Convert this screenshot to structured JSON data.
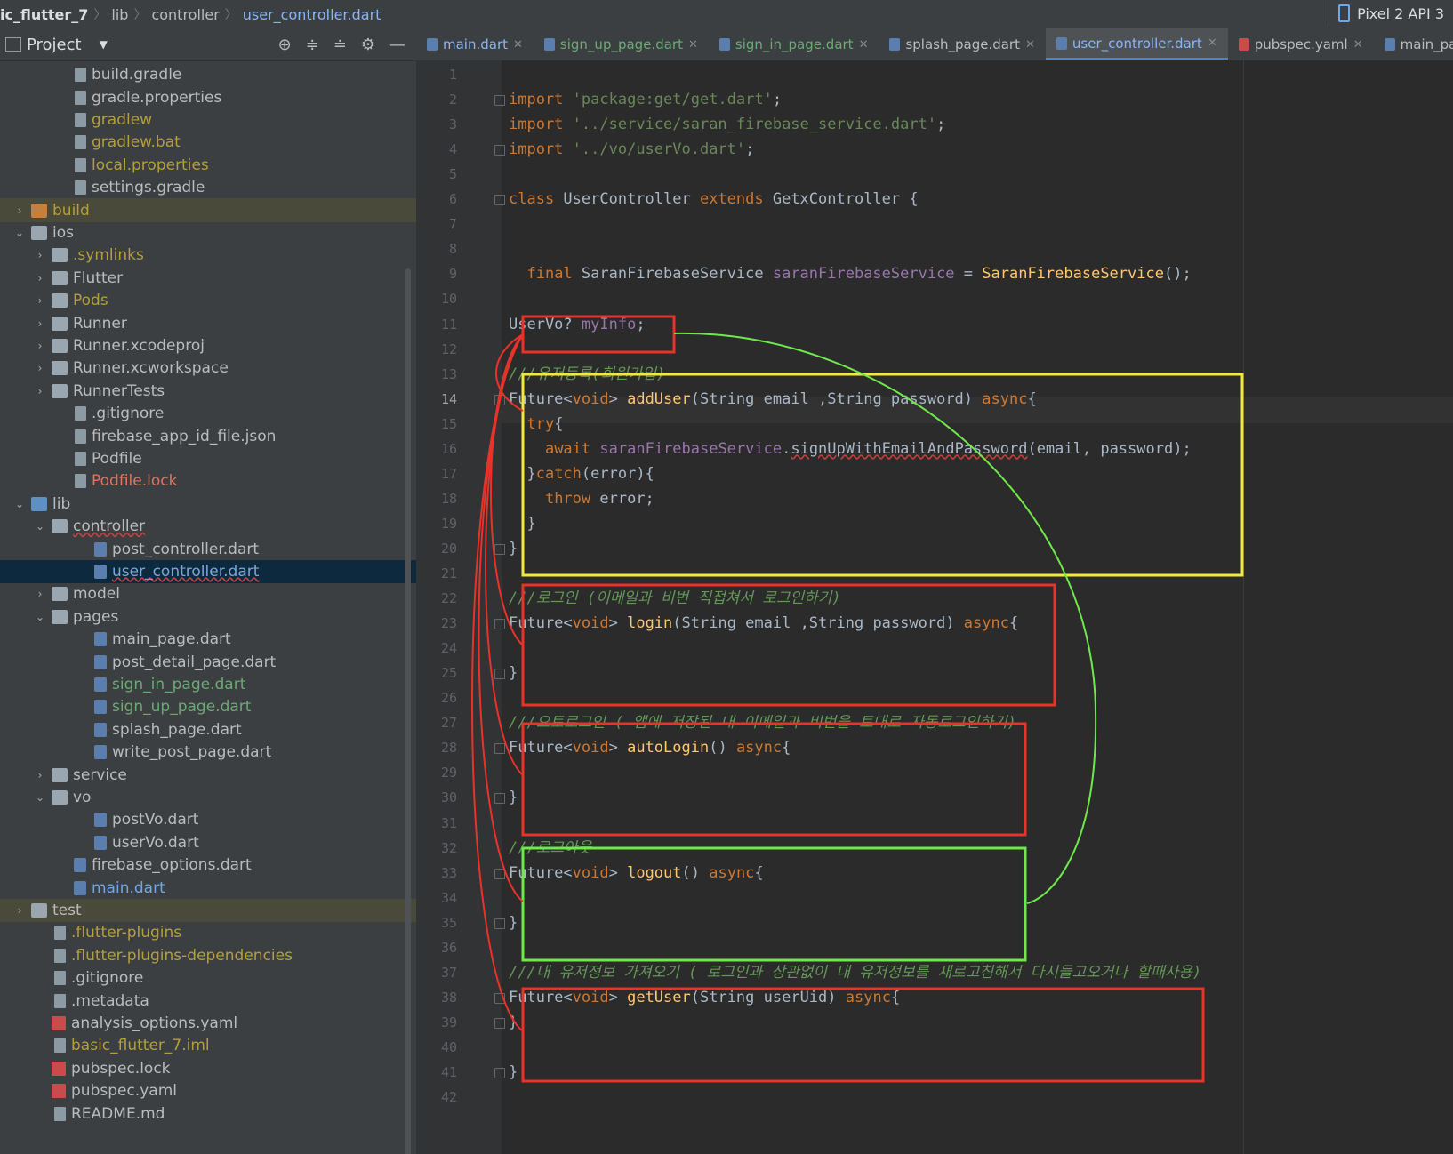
{
  "breadcrumb": {
    "project": "ic_flutter_7",
    "dir1": "lib",
    "dir2": "controller",
    "file": "user_controller.dart"
  },
  "device": {
    "label": "Pixel 2 API 3"
  },
  "project_panel": {
    "title": "Project"
  },
  "tree": [
    {
      "indent": 3,
      "arrow": "",
      "icon": "gradle",
      "name": "build.gradle",
      "color": ""
    },
    {
      "indent": 3,
      "arrow": "",
      "icon": "file",
      "name": "gradle.properties",
      "color": ""
    },
    {
      "indent": 3,
      "arrow": "",
      "icon": "file",
      "name": "gradlew",
      "color": "gold"
    },
    {
      "indent": 3,
      "arrow": "",
      "icon": "file",
      "name": "gradlew.bat",
      "color": "gold"
    },
    {
      "indent": 3,
      "arrow": "",
      "icon": "file",
      "name": "local.properties",
      "color": "gold"
    },
    {
      "indent": 3,
      "arrow": "",
      "icon": "gradle",
      "name": "settings.gradle",
      "color": ""
    },
    {
      "indent": 1,
      "arrow": "›",
      "icon": "folder-orange",
      "name": "build",
      "color": "gold",
      "hl": true
    },
    {
      "indent": 1,
      "arrow": "⌄",
      "icon": "folder",
      "name": "ios",
      "color": ""
    },
    {
      "indent": 2,
      "arrow": "›",
      "icon": "folder",
      "name": ".symlinks",
      "color": "gold"
    },
    {
      "indent": 2,
      "arrow": "›",
      "icon": "folder",
      "name": "Flutter",
      "color": ""
    },
    {
      "indent": 2,
      "arrow": "›",
      "icon": "folder",
      "name": "Pods",
      "color": "gold"
    },
    {
      "indent": 2,
      "arrow": "›",
      "icon": "folder",
      "name": "Runner",
      "color": ""
    },
    {
      "indent": 2,
      "arrow": "›",
      "icon": "folder",
      "name": "Runner.xcodeproj",
      "color": ""
    },
    {
      "indent": 2,
      "arrow": "›",
      "icon": "folder",
      "name": "Runner.xcworkspace",
      "color": ""
    },
    {
      "indent": 2,
      "arrow": "›",
      "icon": "folder",
      "name": "RunnerTests",
      "color": ""
    },
    {
      "indent": 3,
      "arrow": "",
      "icon": "file",
      "name": ".gitignore",
      "color": ""
    },
    {
      "indent": 3,
      "arrow": "",
      "icon": "file",
      "name": "firebase_app_id_file.json",
      "color": ""
    },
    {
      "indent": 3,
      "arrow": "",
      "icon": "file",
      "name": "Podfile",
      "color": ""
    },
    {
      "indent": 3,
      "arrow": "",
      "icon": "file",
      "name": "Podfile.lock",
      "color": "red"
    },
    {
      "indent": 1,
      "arrow": "⌄",
      "icon": "folder-blue",
      "name": "lib",
      "color": ""
    },
    {
      "indent": 2,
      "arrow": "⌄",
      "icon": "folder",
      "name": "controller",
      "color": "",
      "err": true
    },
    {
      "indent": 4,
      "arrow": "",
      "icon": "dart",
      "name": "post_controller.dart",
      "color": ""
    },
    {
      "indent": 4,
      "arrow": "",
      "icon": "dart",
      "name": "user_controller.dart",
      "color": "link",
      "sel": true
    },
    {
      "indent": 2,
      "arrow": "›",
      "icon": "folder",
      "name": "model",
      "color": ""
    },
    {
      "indent": 2,
      "arrow": "⌄",
      "icon": "folder",
      "name": "pages",
      "color": ""
    },
    {
      "indent": 4,
      "arrow": "",
      "icon": "dart",
      "name": "main_page.dart",
      "color": ""
    },
    {
      "indent": 4,
      "arrow": "",
      "icon": "dart",
      "name": "post_detail_page.dart",
      "color": ""
    },
    {
      "indent": 4,
      "arrow": "",
      "icon": "dart",
      "name": "sign_in_page.dart",
      "color": "green"
    },
    {
      "indent": 4,
      "arrow": "",
      "icon": "dart",
      "name": "sign_up_page.dart",
      "color": "green"
    },
    {
      "indent": 4,
      "arrow": "",
      "icon": "dart",
      "name": "splash_page.dart",
      "color": ""
    },
    {
      "indent": 4,
      "arrow": "",
      "icon": "dart",
      "name": "write_post_page.dart",
      "color": ""
    },
    {
      "indent": 2,
      "arrow": "›",
      "icon": "folder",
      "name": "service",
      "color": ""
    },
    {
      "indent": 2,
      "arrow": "⌄",
      "icon": "folder",
      "name": "vo",
      "color": ""
    },
    {
      "indent": 4,
      "arrow": "",
      "icon": "dart",
      "name": "postVo.dart",
      "color": ""
    },
    {
      "indent": 4,
      "arrow": "",
      "icon": "dart",
      "name": "userVo.dart",
      "color": ""
    },
    {
      "indent": 3,
      "arrow": "",
      "icon": "dart",
      "name": "firebase_options.dart",
      "color": ""
    },
    {
      "indent": 3,
      "arrow": "",
      "icon": "dart",
      "name": "main.dart",
      "color": "blue"
    },
    {
      "indent": 1,
      "arrow": "›",
      "icon": "folder",
      "name": "test",
      "color": "",
      "hl": true
    },
    {
      "indent": 2,
      "arrow": "",
      "icon": "file",
      "name": ".flutter-plugins",
      "color": "gold"
    },
    {
      "indent": 2,
      "arrow": "",
      "icon": "file",
      "name": ".flutter-plugins-dependencies",
      "color": "gold"
    },
    {
      "indent": 2,
      "arrow": "",
      "icon": "file",
      "name": ".gitignore",
      "color": ""
    },
    {
      "indent": 2,
      "arrow": "",
      "icon": "file",
      "name": ".metadata",
      "color": ""
    },
    {
      "indent": 2,
      "arrow": "",
      "icon": "yaml",
      "name": "analysis_options.yaml",
      "color": ""
    },
    {
      "indent": 2,
      "arrow": "",
      "icon": "file",
      "name": "basic_flutter_7.iml",
      "color": "gold"
    },
    {
      "indent": 2,
      "arrow": "",
      "icon": "yaml",
      "name": "pubspec.lock",
      "color": ""
    },
    {
      "indent": 2,
      "arrow": "",
      "icon": "yaml",
      "name": "pubspec.yaml",
      "color": ""
    },
    {
      "indent": 2,
      "arrow": "",
      "icon": "file",
      "name": "README.md",
      "color": ""
    }
  ],
  "tabs": [
    {
      "label": "main.dart",
      "style": "blue",
      "close": true
    },
    {
      "label": "sign_up_page.dart",
      "style": "green",
      "close": true
    },
    {
      "label": "sign_in_page.dart",
      "style": "green",
      "close": true
    },
    {
      "label": "splash_page.dart",
      "style": "",
      "close": true
    },
    {
      "label": "user_controller.dart",
      "style": "active",
      "close": true
    },
    {
      "label": "pubspec.yaml",
      "style": "",
      "close": true,
      "yml": true
    },
    {
      "label": "main_pa",
      "style": "",
      "close": false
    }
  ],
  "code_lines": [
    "",
    "[kw]import[/] [str]'package:get/get.dart'[/];",
    "[kw]import[/] [str]'../service/saran_firebase_service.dart'[/];",
    "[kw]import[/] [str]'../vo/userVo.dart'[/];",
    "",
    "[kw]class[/] UserController [kw]extends[/] GetxController {",
    "",
    "",
    "  [kw]final[/] SaranFirebaseService [fld]saranFirebaseService[/] = [fn]SaranFirebaseService[/]();",
    "",
    "UserVo? [fld]myInfo[/];",
    "",
    "[cm]///유저등록(회원가입)[/]",
    "Future<[kw]void[/]> [fn]addUser[/](String email ,String password) [kw]async[/]{",
    "  [kw]try[/]{",
    "    [kw]await[/] [fld]saranFirebaseService[/].[err]signUpWithEmailAndPassword[/](email, password);",
    "  }[kw]catch[/](error){",
    "    [kw]throw[/] error;",
    "  }",
    "}",
    "",
    "[cm]///로그인 (이메일과 비번 직접쳐서 로그인하기)[/]",
    "Future<[kw]void[/]> [fn]login[/](String email ,String password) [kw]async[/]{",
    "",
    "}",
    "",
    "[cm]///오토로그인 ( 앱에 저장된 내 이메일과 비번을 토대로 자동로그인하기)[/]",
    "Future<[kw]void[/]> [fn]autoLogin[/]() [kw]async[/]{",
    "",
    "}",
    "",
    "[cm]///로그아웃[/]",
    "Future<[kw]void[/]> [fn]logout[/]() [kw]async[/]{",
    "",
    "}",
    "",
    "[cm]///내 유저정보 가져오기 ( 로그인과 상관없이 내 유저정보를 새로고침해서 다시들고오거나 할때사용)[/]",
    "Future<[kw]void[/]> [fn]getUser[/](String userUid) [kw]async[/]{",
    "}",
    "",
    "}",
    ""
  ],
  "current_line": 14,
  "colors": {
    "annotation_red": "#e8322a",
    "annotation_yellow": "#f2e840",
    "annotation_green": "#6ee84a"
  }
}
